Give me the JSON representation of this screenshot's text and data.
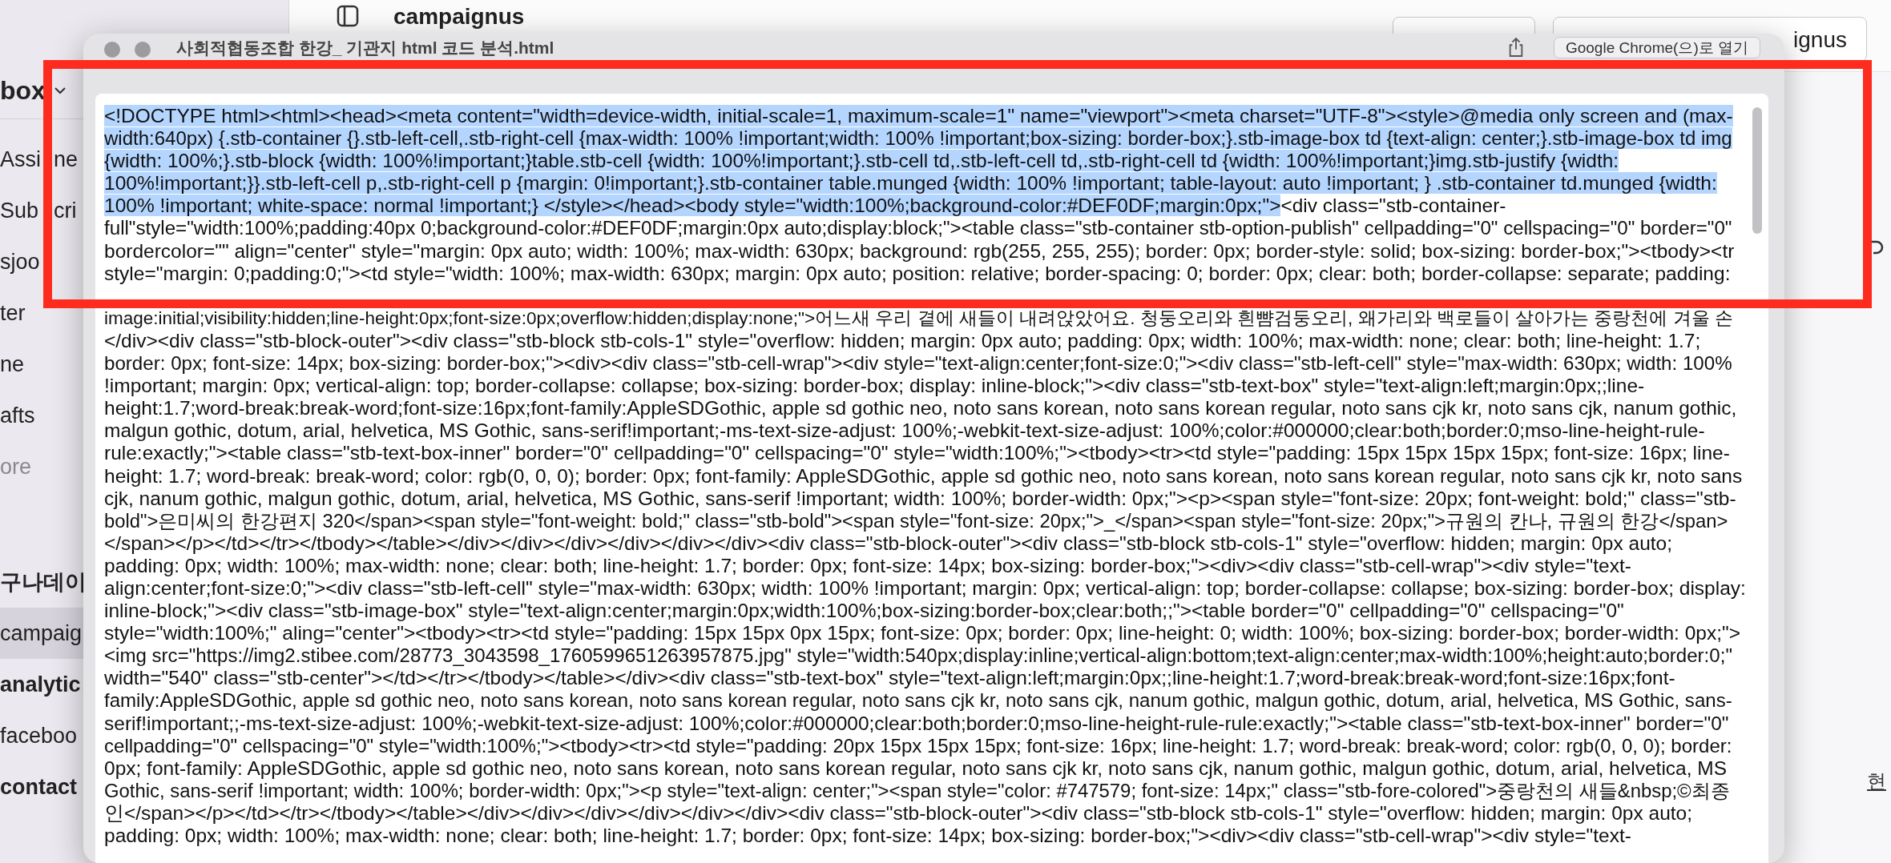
{
  "sidebar": {
    "title": "box",
    "items": [
      {
        "label_parts": [
          "Assi",
          "ne"
        ],
        "kind": "item",
        "selected": false
      },
      {
        "label_parts": [
          "Sub",
          "cri"
        ],
        "kind": "item",
        "selected": false
      },
      {
        "label": "sjoo",
        "kind": "item",
        "selected": false
      },
      {
        "label": "ter",
        "kind": "item",
        "selected": false
      },
      {
        "label": "ne",
        "kind": "item",
        "selected": false
      },
      {
        "label": "afts",
        "kind": "item",
        "selected": false
      },
      {
        "label": "ore",
        "kind": "more",
        "selected": false
      },
      {
        "label": "구나데이",
        "kind": "heading",
        "selected": false
      },
      {
        "label": "campaig",
        "kind": "item",
        "selected": true
      },
      {
        "label": "analytic",
        "kind": "heading",
        "selected": false
      },
      {
        "label": "faceboo",
        "kind": "item",
        "selected": false
      },
      {
        "label": "contact",
        "kind": "heading",
        "selected": false
      }
    ]
  },
  "toolbar": {
    "workspace": "campaignus",
    "account_button": "ignus"
  },
  "side_panel": {
    "link": "현"
  },
  "preview_window": {
    "title": "사회적협동조합 한강_ 기관지 html 코드 분석.html",
    "open_button": "Google Chrome(으)로 열기",
    "lines_in_frame": [
      [
        {
          "text": "<!DOCTYPE html><html><head><meta content=\"width=device-width, initial-scale=1, maximum-scale=1\" name=\"viewport\"><meta charset=\"UTF-8\"><style>@media only screen and (max-",
          "selected": true
        }
      ],
      [
        {
          "text": "width:640px) {.stb-container {}.stb-left-cell,.stb-right-cell {max-width: 100% !important;width: 100% !important;box-sizing: border-box;}.stb-image-box td {text-align: center;}.stb-image-box td img",
          "selected": true
        }
      ],
      [
        {
          "text": "{width: 100%;}.stb-block {width: 100%!important;}table.stb-cell {width: 100%!important;}.stb-cell td,.stb-left-cell td,.stb-right-cell td {width: 100%!important;}img.stb-justify {width:",
          "selected": true
        }
      ],
      [
        {
          "text": "100%!important;}}.stb-left-cell p,.stb-right-cell p {margin: 0!important;}.stb-container table.munged {width: 100% !important; table-layout: auto !important; } .stb-container td.munged {width:",
          "selected": true
        }
      ],
      [
        {
          "text": "100% !important; white-space: normal !important;} </style></head><body style=\"width:100%;background-color:#DEF0DF;margin:0px;\">",
          "selected": true
        },
        {
          "text": "<div class=\"stb-container-",
          "selected": false
        }
      ],
      [
        {
          "text": "full\"style=\"width:100%;padding:40px 0;background-color:#DEF0DF;margin:0px auto;display:block;\"><table class=\"stb-container stb-option-publish\" cellpadding=\"0\" cellspacing=\"0\" border=\"0\"",
          "selected": false
        }
      ],
      [
        {
          "text": "bordercolor=\"\" align=\"center\" style=\"margin: 0px auto; width: 100%; max-width: 630px; background: rgb(255, 255, 255); border: 0px; border-style: solid; box-sizing: border-box;\"><tbody><tr",
          "selected": false
        }
      ],
      [
        {
          "text": "style=\"margin: 0;padding:0;\"><td style=\"width: 100%; max-width: 630px; margin: 0px auto; position: relative; border-spacing: 0; border: 0px; clear: both; border-collapse: separate; padding:",
          "selected": false
        }
      ]
    ],
    "lines_below_frame": [
      [
        {
          "text": "image:initial;visibility:hidden;line-height:0px;font-size:0px;overflow:hidden;display:none;\">어느새 우리 곁에 새들이 내려앉았어요. 청둥오리와 흰뺨검둥오리, 왜가리와 백로들이 살아가는 중랑천에 겨울 손",
          "selected": false
        }
      ],
      [
        {
          "text": "</div><div class=\"stb-block-outer\"><div class=\"stb-block stb-cols-1\" style=\"overflow: hidden; margin: 0px auto; padding: 0px; width: 100%; max-width: none; clear: both; line-height: 1.7;",
          "selected": false
        }
      ],
      [
        {
          "text": "border: 0px; font-size: 14px; box-sizing: border-box;\"><div><div class=\"stb-cell-wrap\"><div style=\"text-align:center;font-size:0;\"><div class=\"stb-left-cell\" style=\"max-width: 630px; width: 100%",
          "selected": false
        }
      ],
      [
        {
          "text": "!important; margin: 0px; vertical-align: top; border-collapse: collapse; box-sizing: border-box; display: inline-block;\"><div class=\"stb-text-box\" style=\"text-align:left;margin:0px;;line-",
          "selected": false
        }
      ],
      [
        {
          "text": "height:1.7;word-break:break-word;font-size:16px;font-family:AppleSDGothic, apple sd gothic neo, noto sans korean, noto sans korean regular, noto sans cjk kr, noto sans cjk, nanum gothic,",
          "selected": false
        }
      ],
      [
        {
          "text": "malgun gothic, dotum, arial, helvetica, MS Gothic, sans-serif!important;-ms-text-size-adjust: 100%;-webkit-text-size-adjust: 100%;color:#000000;clear:both;border:0;mso-line-height-rule-",
          "selected": false
        }
      ],
      [
        {
          "text": "rule:exactly;\"><table class=\"stb-text-box-inner\" border=\"0\" cellpadding=\"0\" cellspacing=\"0\" style=\"width:100%;\"><tbody><tr><td style=\"padding: 15px 15px 15px 15px; font-size: 16px; line-",
          "selected": false
        }
      ],
      [
        {
          "text": "height: 1.7; word-break: break-word; color: rgb(0, 0, 0); border: 0px; font-family: AppleSDGothic, apple sd gothic neo, noto sans korean, noto sans korean regular, noto sans cjk kr, noto sans",
          "selected": false
        }
      ],
      [
        {
          "text": "cjk, nanum gothic, malgun gothic, dotum, arial, helvetica, MS Gothic, sans-serif !important; width: 100%; border-width: 0px;\"><p><span style=\"font-size: 20px; font-weight: bold;\" class=\"stb-",
          "selected": false
        }
      ],
      [
        {
          "text": "bold\">은미씨의 한강편지 320</span><span style=\"font-weight: bold;\" class=\"stb-bold\"><span style=\"font-size: 20px;\">_</span><span style=\"font-size: 20px;\">규원의 칸나, 규원의 한강</span>",
          "selected": false
        }
      ],
      [
        {
          "text": "</span></p></td></tr></tbody></table></div></div></div></div></div></div><div class=\"stb-block-outer\"><div class=\"stb-block stb-cols-1\" style=\"overflow: hidden; margin: 0px auto;",
          "selected": false
        }
      ],
      [
        {
          "text": "padding: 0px; width: 100%; max-width: none; clear: both; line-height: 1.7; border: 0px; font-size: 14px; box-sizing: border-box;\"><div><div class=\"stb-cell-wrap\"><div style=\"text-",
          "selected": false
        }
      ],
      [
        {
          "text": "align:center;font-size:0;\"><div class=\"stb-left-cell\" style=\"max-width: 630px; width: 100% !important; margin: 0px; vertical-align: top; border-collapse: collapse; box-sizing: border-box; display:",
          "selected": false
        }
      ],
      [
        {
          "text": "inline-block;\"><div class=\"stb-image-box\" style=\"text-align:center;margin:0px;width:100%;box-sizing:border-box;clear:both;;\"><table border=\"0\" cellpadding=\"0\" cellspacing=\"0\"",
          "selected": false
        }
      ],
      [
        {
          "text": "style=\"width:100%;\" aling=\"center\"><tbody><tr><td style=\"padding: 15px 15px 0px 15px; font-size: 0px; border: 0px; line-height: 0; width: 100%; box-sizing: border-box; border-width: 0px;\">",
          "selected": false
        }
      ],
      [
        {
          "text": "<img src=\"https://img2.stibee.com/28773_3043598_1760599651263957875.jpg\" style=\"width:540px;display:inline;vertical-align:bottom;text-align:center;max-width:100%;height:auto;border:0;\"",
          "selected": false
        }
      ],
      [
        {
          "text": "width=\"540\" class=\"stb-center\"></td></tr></tbody></table></div><div class=\"stb-text-box\" style=\"text-align:left;margin:0px;;line-height:1.7;word-break:break-word;font-size:16px;font-",
          "selected": false
        }
      ],
      [
        {
          "text": "family:AppleSDGothic, apple sd gothic neo, noto sans korean, noto sans korean regular, noto sans cjk kr, noto sans cjk, nanum gothic, malgun gothic, dotum, arial, helvetica, MS Gothic, sans-",
          "selected": false
        }
      ],
      [
        {
          "text": "serif!important;;-ms-text-size-adjust: 100%;-webkit-text-size-adjust: 100%;color:#000000;clear:both;border:0;mso-line-height-rule-rule:exactly;\"><table class=\"stb-text-box-inner\" border=\"0\"",
          "selected": false
        }
      ],
      [
        {
          "text": "cellpadding=\"0\" cellspacing=\"0\" style=\"width:100%;\"><tbody><tr><td style=\"padding: 20px 15px 15px 15px; font-size: 16px; line-height: 1.7; word-break: break-word; color: rgb(0, 0, 0); border:",
          "selected": false
        }
      ],
      [
        {
          "text": "0px; font-family: AppleSDGothic, apple sd gothic neo, noto sans korean, noto sans korean regular, noto sans cjk kr, noto sans cjk, nanum gothic, malgun gothic, dotum, arial, helvetica, MS",
          "selected": false
        }
      ],
      [
        {
          "text": "Gothic, sans-serif !important; width: 100%; border-width: 0px;\"><p style=\"text-align: center;\"><span style=\"color: #747579; font-size: 14px;\" class=\"stb-fore-colored\">중랑천의 새들&nbsp;©최종",
          "selected": false
        }
      ],
      [
        {
          "text": "인</span></p></td></tr></tbody></table></div></div></div></div></div></div><div class=\"stb-block-outer\"><div class=\"stb-block stb-cols-1\" style=\"overflow: hidden; margin: 0px auto;",
          "selected": false
        }
      ],
      [
        {
          "text": "padding: 0px; width: 100%; max-width: none; clear: both; line-height: 1.7; border: 0px; font-size: 14px; box-sizing: border-box;\"><div><div class=\"stb-cell-wrap\"><div style=\"text-",
          "selected": false
        }
      ]
    ]
  }
}
